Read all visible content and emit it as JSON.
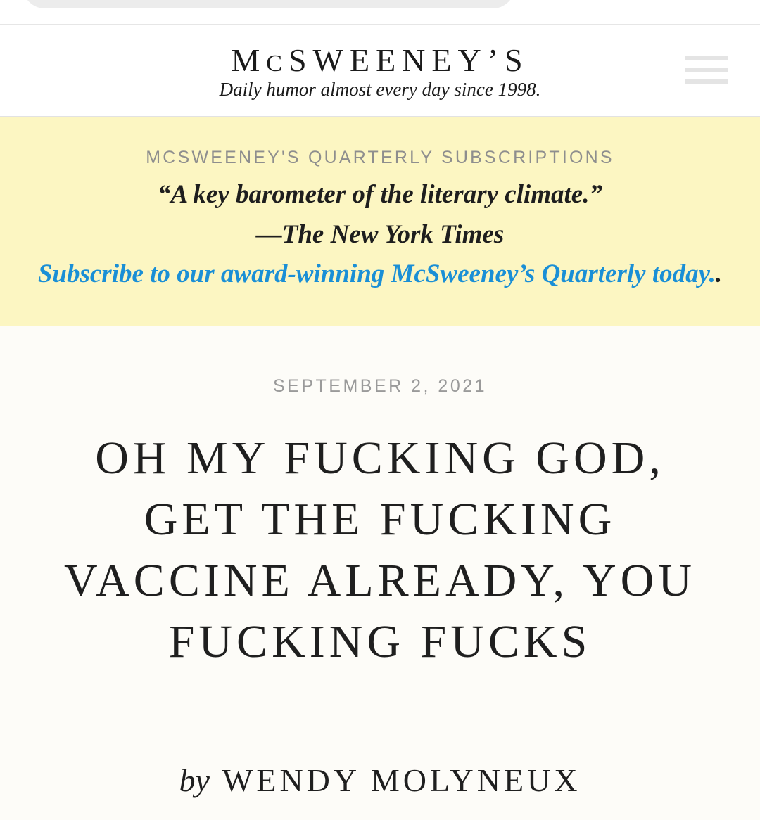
{
  "header": {
    "brand_first": "M",
    "brand_small": "C",
    "brand_rest": "SWEENEY’S",
    "tagline": "Daily humor almost every day since 1998."
  },
  "promo": {
    "eyebrow": "MCSWEENEY'S QUARTERLY SUBSCRIPTIONS",
    "quote": "“A key barometer of the literary climate.”",
    "source": "—The New York Times",
    "link": "Subscribe to our award-winning McSweeney’s Quarterly today.",
    "link_tail": "."
  },
  "article": {
    "date": "SEPTEMBER 2, 2021",
    "title": "OH MY FUCKING GOD, GET THE FUCKING VACCINE ALREADY, YOU FUCKING FUCKS",
    "by": "by",
    "author": "WENDY MOLYNEUX"
  },
  "colors": {
    "banner_bg": "#fcf6c2",
    "link": "#1a8fd6",
    "muted": "#9a9a9a"
  },
  "icons": {
    "menu": "hamburger-menu-icon"
  }
}
